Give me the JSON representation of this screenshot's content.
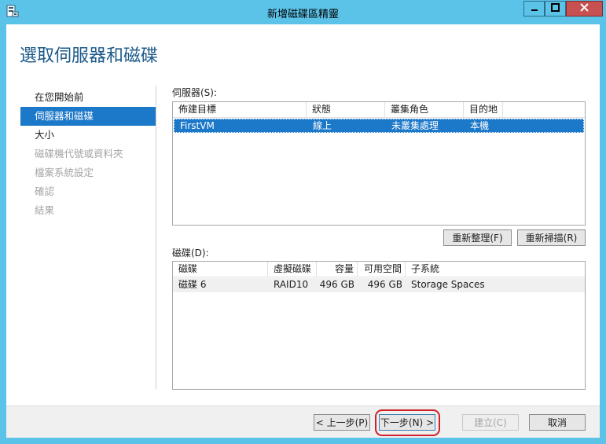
{
  "window": {
    "title": "新增磁碟區精靈",
    "controls": {
      "minimize_icon": "minimize-icon",
      "maximize_icon": "maximize-icon",
      "close_icon": "close-icon"
    }
  },
  "page_title": "選取伺服器和磁碟",
  "nav": {
    "items": [
      {
        "label": "在您開始前",
        "state": "normal"
      },
      {
        "label": "伺服器和磁碟",
        "state": "active"
      },
      {
        "label": "大小",
        "state": "normal"
      },
      {
        "label": "磁碟機代號或資料夾",
        "state": "disabled"
      },
      {
        "label": "檔案系統設定",
        "state": "disabled"
      },
      {
        "label": "確認",
        "state": "disabled"
      },
      {
        "label": "結果",
        "state": "disabled"
      }
    ]
  },
  "servers": {
    "label": "伺服器(S):",
    "columns": [
      "佈建目標",
      "狀態",
      "叢集角色",
      "目的地"
    ],
    "rows": [
      {
        "target": "FirstVM",
        "status": "線上",
        "cluster_role": "未叢集處理",
        "destination": "本機",
        "selected": true
      }
    ],
    "refresh_button": "重新整理(F)",
    "rescan_button": "重新掃描(R)"
  },
  "disks": {
    "label": "磁碟(D):",
    "columns": [
      "磁碟",
      "虛擬磁碟",
      "容量",
      "可用空間",
      "子系統"
    ],
    "rows": [
      {
        "disk": "磁碟 6",
        "virtual_disk": "RAID10",
        "capacity": "496 GB",
        "free_space": "496 GB",
        "subsystem": "Storage Spaces"
      }
    ]
  },
  "footer": {
    "previous": "< 上一步(P)",
    "next": "下一步(N) >",
    "create": "建立(C)",
    "cancel": "取消"
  },
  "colors": {
    "title_bar": "#5bc2e8",
    "accent": "#1c78c8",
    "heading": "#1c5a8a",
    "annotation": "#d0202a"
  }
}
